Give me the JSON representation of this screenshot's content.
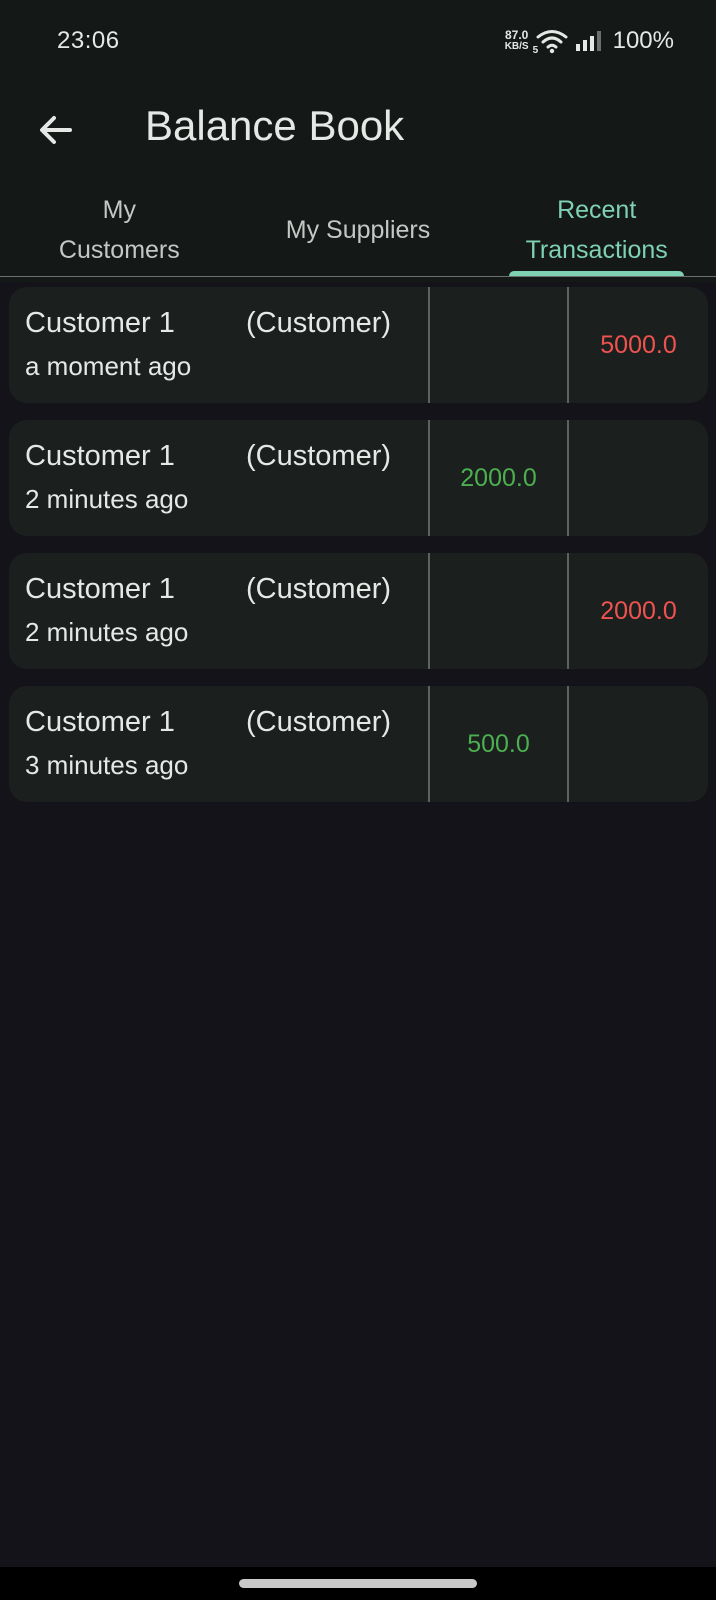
{
  "status_bar": {
    "time": "23:06",
    "net_speed_value": "87.0",
    "net_speed_unit": "KB/S",
    "wifi_badge": "5",
    "battery": "100%"
  },
  "app_bar": {
    "title": "Balance Book",
    "back_icon": "arrow-left-icon"
  },
  "tabs": [
    {
      "label": "My\nCustomers",
      "active": false
    },
    {
      "label": "My Suppliers",
      "active": false
    },
    {
      "label": "Recent\nTransactions",
      "active": true
    }
  ],
  "colors": {
    "accent": "#7fd1b3",
    "amount_got": "#4caf50",
    "amount_gave": "#ef5350",
    "card_bg": "#1b1f1e",
    "page_bg": "#15131a"
  },
  "transactions": [
    {
      "name": "Customer 1",
      "type": "(Customer)",
      "time": "a moment ago",
      "got": "",
      "gave": "5000.0"
    },
    {
      "name": "Customer 1",
      "type": "(Customer)",
      "time": "2 minutes ago",
      "got": "2000.0",
      "gave": ""
    },
    {
      "name": "Customer 1",
      "type": "(Customer)",
      "time": "2 minutes ago",
      "got": "",
      "gave": "2000.0"
    },
    {
      "name": "Customer 1",
      "type": "(Customer)",
      "time": "3 minutes ago",
      "got": "500.0",
      "gave": ""
    }
  ]
}
